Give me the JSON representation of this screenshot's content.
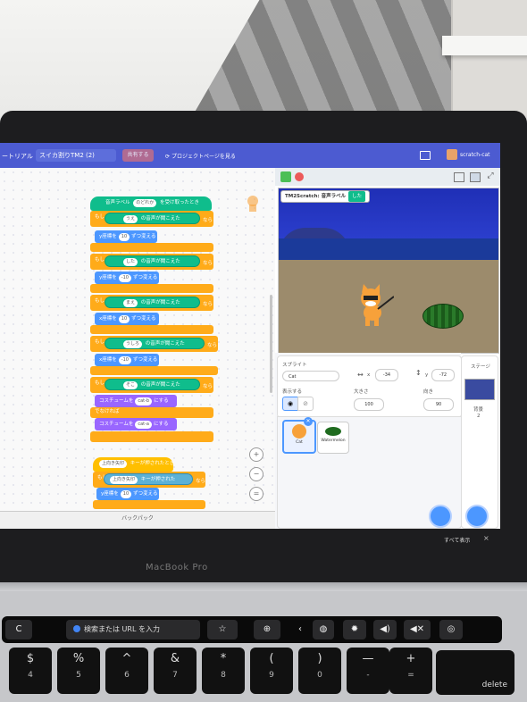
{
  "menubar": {
    "tutorial_fragment": "ートリアル",
    "project_title": "スイカ割りTM2 (2)",
    "save_label": "共有する",
    "see_project_page": "プロジェクトページを見る",
    "username": "scratch-cat"
  },
  "blocks": {
    "hat": {
      "prefix": "音声ラベル",
      "dropdown": "のどれか",
      "suffix": "を受け取ったとき"
    },
    "if1": {
      "keyword": "もし",
      "label": "うえ",
      "cond": "の音声が聞こえた",
      "then": "なら"
    },
    "motion1": {
      "prefix": "y座標を",
      "value": "10",
      "suffix": "ずつ変える"
    },
    "if2": {
      "keyword": "もし",
      "label": "した",
      "cond": "の音声が聞こえた",
      "then": "なら"
    },
    "motion2": {
      "prefix": "y座標を",
      "value": "-10",
      "suffix": "ずつ変える"
    },
    "if3": {
      "keyword": "もし",
      "label": "まえ",
      "cond": "の音声が聞こえた",
      "then": "なら"
    },
    "motion3": {
      "prefix": "x座標を",
      "value": "10",
      "suffix": "ずつ変える"
    },
    "if4": {
      "keyword": "もし",
      "label": "うしろ",
      "cond": "の音声が聞こえた",
      "then": "なら"
    },
    "motion4": {
      "prefix": "x座標を",
      "value": "-10",
      "suffix": "ずつ変える"
    },
    "if5": {
      "keyword": "もし",
      "label": "そこ",
      "cond": "の音声が聞こえた",
      "then": "なら"
    },
    "looks1": {
      "prefix": "コスチュームを",
      "value": "cat-b",
      "suffix": "にする"
    },
    "else_label": "でなければ",
    "looks2": {
      "prefix": "コスチュームを",
      "value": "cat-a",
      "suffix": "にする"
    },
    "key_hat": {
      "value": "上向き矢印",
      "suffix": "キーが押されたとき"
    },
    "if6": {
      "keyword": "もし",
      "value": "上向き矢印",
      "cond": "キーが押された",
      "then": "なら"
    },
    "motion5": {
      "prefix": "y座標を",
      "value": "10",
      "suffix": "ずつ変える"
    }
  },
  "zoom": {
    "in": "+",
    "out": "−",
    "reset": "="
  },
  "backpack": "バックパック",
  "stage": {
    "monitor_label": "TM2Scratch: 音声ラベル",
    "monitor_value": "した"
  },
  "sprite_info": {
    "sprite_label": "スプライト",
    "sprite_name": "Cat",
    "x_label": "x",
    "x_value": "-34",
    "y_label": "y",
    "y_value": "-72",
    "show_label": "表示する",
    "size_label": "大きさ",
    "size_value": "100",
    "direction_label": "向き",
    "direction_value": "90"
  },
  "sprites": [
    {
      "name": "Cat"
    },
    {
      "name": "Watermelon"
    }
  ],
  "stage_panel": {
    "label": "ステージ",
    "backdrop_label": "背景",
    "backdrop_count": "2"
  },
  "notification": {
    "text": "すべて表示",
    "close": "×"
  },
  "laptop": {
    "brand": "MacBook Pro"
  },
  "touchbar": {
    "reload": "C",
    "url_placeholder": "検索または URL を入力",
    "delete_key": "delete"
  },
  "keys": [
    {
      "top": "$",
      "bottom": "4"
    },
    {
      "top": "%",
      "bottom": "5"
    },
    {
      "top": "^",
      "bottom": "6"
    },
    {
      "top": "&",
      "bottom": "7"
    },
    {
      "top": "*",
      "bottom": "8"
    },
    {
      "top": "(",
      "bottom": "9"
    },
    {
      "top": ")",
      "bottom": "0"
    },
    {
      "top": "—",
      "bottom": "-"
    },
    {
      "top": "+",
      "bottom": "="
    }
  ]
}
